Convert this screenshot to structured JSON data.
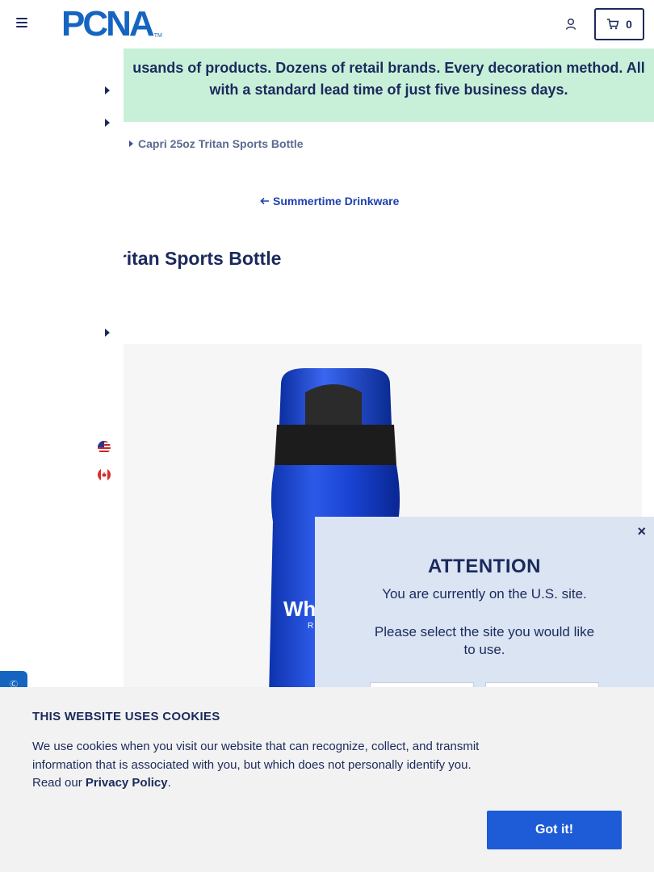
{
  "header": {
    "logo_text": "PCNA",
    "logo_tm": "TM",
    "cart_count": "0"
  },
  "banner": {
    "line1": "usands of products. Dozens of retail brands. Every decoration method. All",
    "line2": "with a standard lead time of just five business days."
  },
  "breadcrumb": {
    "current": "Capri 25oz Tritan Sports Bottle"
  },
  "back_link": {
    "label": "Summertime Drinkware"
  },
  "product": {
    "title": "Tritan Sports Bottle",
    "image_icon": "blue-sports-bottle-image"
  },
  "chat": {
    "label": "Ⓒ"
  },
  "attention_modal": {
    "close_label": "×",
    "title": "ATTENTION",
    "message1": "You are currently on the U.S. site.",
    "message2": "Please select the site you would like to use."
  },
  "cookie_banner": {
    "title": "THIS WEBSITE USES COOKIES",
    "text_before": "We use cookies when you visit our website that can recognize, collect, and transmit information that is associated with you, but which does not personally identify you. Read our ",
    "link_text": "Privacy Policy",
    "text_after": ".",
    "button_label": "Got it!"
  },
  "colors": {
    "brand_blue": "#1565c0",
    "navy": "#1b2a5c",
    "banner_green": "#c8f0d8",
    "modal_bg": "#dbe4f3",
    "cookie_button": "#1e5bd6"
  }
}
